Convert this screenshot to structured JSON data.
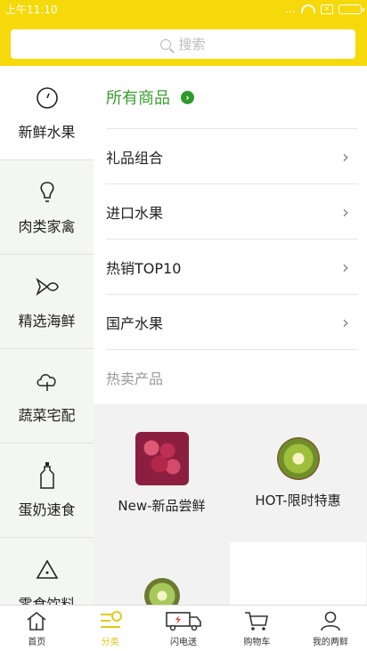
{
  "status": {
    "time": "上午11:10",
    "dots": "..."
  },
  "search": {
    "placeholder": "搜索"
  },
  "sidebar": {
    "items": [
      {
        "label": "新鲜水果",
        "icon": "clock-icon"
      },
      {
        "label": "肉类家禽",
        "icon": "bulb-icon"
      },
      {
        "label": "精选海鲜",
        "icon": "fish-icon"
      },
      {
        "label": "蔬菜宅配",
        "icon": "cloud-icon"
      },
      {
        "label": "蛋奶速食",
        "icon": "bottle-icon"
      },
      {
        "label": "零食饮料",
        "icon": "warning-icon"
      }
    ]
  },
  "main": {
    "all_label": "所有商品",
    "categories": [
      "礼品组合",
      "进口水果",
      "热销TOP10",
      "国产水果"
    ],
    "hot_title": "热卖产品",
    "promos": [
      {
        "label": "New-新品尝鲜",
        "image": "grapes"
      },
      {
        "label": "HOT-限时特惠",
        "image": "kiwi"
      }
    ]
  },
  "nav": {
    "items": [
      {
        "label": "首页",
        "icon": "home-icon"
      },
      {
        "label": "分类",
        "icon": "category-icon"
      },
      {
        "label": "闪电送",
        "icon": "delivery-truck-icon"
      },
      {
        "label": "购物车",
        "icon": "cart-icon"
      },
      {
        "label": "我的两鲜",
        "icon": "user-icon"
      }
    ]
  },
  "colors": {
    "accent": "#f5d90a",
    "green": "#3a9d2e"
  }
}
